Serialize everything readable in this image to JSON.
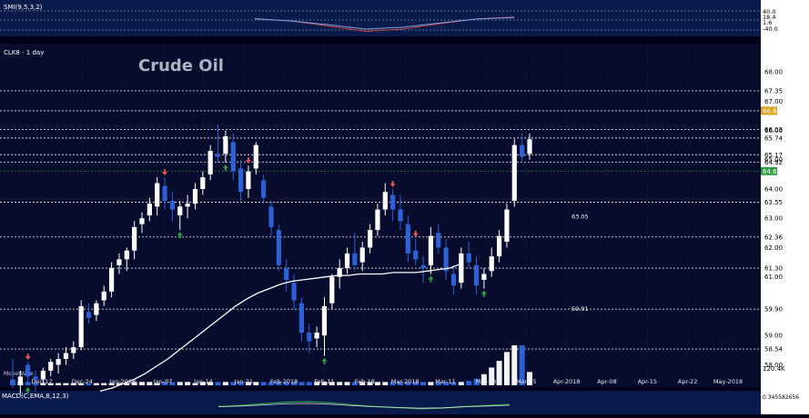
{
  "chart_data": [
    {
      "type": "line",
      "label": "SMI(9,5,3,2)",
      "right_scale": [
        "40.0",
        "18.4",
        "1.6",
        "-40.0"
      ],
      "series": [
        {
          "values": [
            5,
            -4,
            -20,
            -38,
            -30,
            -12,
            4,
            10
          ]
        }
      ]
    },
    {
      "type": "candlestick",
      "label": "CLK8 - 1 day",
      "title": "Crude Oil",
      "ylim": [
        57.3,
        68.9
      ],
      "right_ticks": [
        "68.00",
        "67.00",
        "66.00",
        "65.00",
        "64.00",
        "63.00",
        "62.00",
        "61.00",
        "59.00",
        "58.00"
      ],
      "level_lines": [
        {
          "value": 67.35,
          "label": "67.35"
        },
        {
          "value": 66.67,
          "label": "66.67",
          "badge_color": "#d9a21b"
        },
        {
          "value": 66.03,
          "label": "66.03"
        },
        {
          "value": 65.74,
          "label": "65.74"
        },
        {
          "value": 65.17,
          "label": "65.17"
        },
        {
          "value": 64.92,
          "label": "64.92"
        },
        {
          "value": 64.61,
          "label": "64.61",
          "badge_color": "#2ea043"
        },
        {
          "value": 63.55,
          "label": "63.55"
        },
        {
          "value": 62.36,
          "label": "62.36"
        },
        {
          "value": 61.3,
          "label": "61.30"
        },
        {
          "value": 59.9,
          "label": "59.90"
        },
        {
          "value": 58.54,
          "label": "58.54"
        }
      ],
      "inline_labels": [
        {
          "value": 63.05,
          "label": "63.05"
        },
        {
          "value": 59.91,
          "label": "59.91"
        }
      ],
      "x_ticks": [
        "Dec-17",
        "Dec-24",
        "Jan-2018",
        "Jan-07",
        "Jan-14",
        "Jan-21",
        "Feb-2018",
        "Feb-11",
        "Feb-18",
        "Mar-2018",
        "Mar-11",
        "Mar-18",
        "Mar-25",
        "Apr-2018",
        "Apr-08",
        "Apr-15",
        "Apr-22",
        "May-2018"
      ],
      "candles": [
        {
          "o": 57.5,
          "h": 58.2,
          "l": 57.2,
          "c": 57.4
        },
        {
          "o": 57.4,
          "h": 57.8,
          "l": 57.0,
          "c": 57.6
        },
        {
          "o": 58.0,
          "h": 58.1,
          "l": 57.3,
          "c": 57.6
        },
        {
          "o": 57.6,
          "h": 57.8,
          "l": 57.1,
          "c": 57.5
        },
        {
          "o": 57.5,
          "h": 57.9,
          "l": 57.3,
          "c": 57.8
        },
        {
          "o": 57.8,
          "h": 58.2,
          "l": 57.6,
          "c": 58.1
        },
        {
          "o": 58.0,
          "h": 58.4,
          "l": 57.7,
          "c": 58.2
        },
        {
          "o": 58.2,
          "h": 58.6,
          "l": 58.0,
          "c": 58.4
        },
        {
          "o": 58.4,
          "h": 58.8,
          "l": 58.2,
          "c": 58.6
        },
        {
          "o": 58.6,
          "h": 60.2,
          "l": 58.5,
          "c": 60.0
        },
        {
          "o": 59.8,
          "h": 60.1,
          "l": 59.4,
          "c": 59.6
        },
        {
          "o": 59.7,
          "h": 60.2,
          "l": 59.5,
          "c": 60.1
        },
        {
          "o": 60.2,
          "h": 60.7,
          "l": 60.0,
          "c": 60.5
        },
        {
          "o": 60.5,
          "h": 61.5,
          "l": 60.3,
          "c": 61.3
        },
        {
          "o": 61.4,
          "h": 61.8,
          "l": 61.1,
          "c": 61.6
        },
        {
          "o": 61.6,
          "h": 62.0,
          "l": 61.2,
          "c": 61.9
        },
        {
          "o": 61.9,
          "h": 62.9,
          "l": 61.6,
          "c": 62.7
        },
        {
          "o": 62.8,
          "h": 63.2,
          "l": 62.5,
          "c": 63.0
        },
        {
          "o": 63.1,
          "h": 63.7,
          "l": 62.9,
          "c": 63.5
        },
        {
          "o": 63.4,
          "h": 64.4,
          "l": 63.1,
          "c": 64.2
        },
        {
          "o": 64.1,
          "h": 64.4,
          "l": 63.3,
          "c": 63.6
        },
        {
          "o": 63.6,
          "h": 63.9,
          "l": 62.9,
          "c": 63.3
        },
        {
          "o": 63.1,
          "h": 63.6,
          "l": 62.6,
          "c": 63.4
        },
        {
          "o": 63.4,
          "h": 63.8,
          "l": 63.0,
          "c": 63.5
        },
        {
          "o": 63.5,
          "h": 64.2,
          "l": 63.3,
          "c": 64.0
        },
        {
          "o": 64.0,
          "h": 64.6,
          "l": 63.8,
          "c": 64.4
        },
        {
          "o": 64.5,
          "h": 65.5,
          "l": 64.3,
          "c": 65.3
        },
        {
          "o": 65.2,
          "h": 66.2,
          "l": 64.9,
          "c": 65.1
        },
        {
          "o": 65.2,
          "h": 66.0,
          "l": 64.9,
          "c": 65.8
        },
        {
          "o": 65.6,
          "h": 65.9,
          "l": 64.3,
          "c": 64.6
        },
        {
          "o": 64.7,
          "h": 65.0,
          "l": 63.6,
          "c": 63.9
        },
        {
          "o": 64.0,
          "h": 64.8,
          "l": 63.7,
          "c": 64.6
        },
        {
          "o": 64.7,
          "h": 65.6,
          "l": 64.5,
          "c": 65.5
        },
        {
          "o": 64.3,
          "h": 64.5,
          "l": 63.5,
          "c": 63.7
        },
        {
          "o": 63.4,
          "h": 63.6,
          "l": 62.4,
          "c": 62.7
        },
        {
          "o": 62.6,
          "h": 62.8,
          "l": 61.2,
          "c": 61.4
        },
        {
          "o": 61.3,
          "h": 61.6,
          "l": 60.5,
          "c": 60.9
        },
        {
          "o": 60.8,
          "h": 61.1,
          "l": 59.9,
          "c": 60.2
        },
        {
          "o": 60.1,
          "h": 60.3,
          "l": 58.8,
          "c": 59.1
        },
        {
          "o": 59.1,
          "h": 59.4,
          "l": 58.4,
          "c": 58.8
        },
        {
          "o": 58.9,
          "h": 59.3,
          "l": 58.6,
          "c": 59.1
        },
        {
          "o": 59.0,
          "h": 60.3,
          "l": 58.3,
          "c": 60.0
        },
        {
          "o": 60.1,
          "h": 61.1,
          "l": 59.9,
          "c": 61.0
        },
        {
          "o": 61.0,
          "h": 61.6,
          "l": 60.6,
          "c": 61.3
        },
        {
          "o": 61.3,
          "h": 62.0,
          "l": 61.1,
          "c": 61.8
        },
        {
          "o": 61.8,
          "h": 62.5,
          "l": 61.2,
          "c": 61.4
        },
        {
          "o": 61.5,
          "h": 62.2,
          "l": 61.2,
          "c": 62.0
        },
        {
          "o": 62.0,
          "h": 62.8,
          "l": 61.8,
          "c": 62.6
        },
        {
          "o": 62.6,
          "h": 63.5,
          "l": 62.4,
          "c": 63.3
        },
        {
          "o": 63.3,
          "h": 64.2,
          "l": 63.1,
          "c": 63.9
        },
        {
          "o": 63.8,
          "h": 64.0,
          "l": 62.9,
          "c": 63.3
        },
        {
          "o": 63.3,
          "h": 63.8,
          "l": 62.6,
          "c": 62.9
        },
        {
          "o": 62.8,
          "h": 63.1,
          "l": 61.5,
          "c": 61.8
        },
        {
          "o": 61.9,
          "h": 62.3,
          "l": 61.4,
          "c": 61.6
        },
        {
          "o": 61.4,
          "h": 61.7,
          "l": 60.8,
          "c": 61.3
        },
        {
          "o": 61.4,
          "h": 62.7,
          "l": 61.1,
          "c": 62.4
        },
        {
          "o": 62.5,
          "h": 62.8,
          "l": 61.8,
          "c": 62.0
        },
        {
          "o": 62.0,
          "h": 62.3,
          "l": 60.9,
          "c": 61.2
        },
        {
          "o": 61.1,
          "h": 61.4,
          "l": 60.4,
          "c": 60.7
        },
        {
          "o": 60.8,
          "h": 62.0,
          "l": 60.6,
          "c": 61.8
        },
        {
          "o": 61.8,
          "h": 62.2,
          "l": 61.3,
          "c": 61.5
        },
        {
          "o": 61.4,
          "h": 61.7,
          "l": 60.4,
          "c": 60.7
        },
        {
          "o": 60.9,
          "h": 61.3,
          "l": 60.6,
          "c": 61.1
        },
        {
          "o": 61.2,
          "h": 62.0,
          "l": 61.0,
          "c": 61.7
        },
        {
          "o": 61.7,
          "h": 62.6,
          "l": 61.5,
          "c": 62.4
        },
        {
          "o": 62.2,
          "h": 63.5,
          "l": 62.0,
          "c": 63.3
        },
        {
          "o": 63.6,
          "h": 65.7,
          "l": 63.4,
          "c": 65.5
        },
        {
          "o": 65.5,
          "h": 65.9,
          "l": 64.9,
          "c": 65.1
        },
        {
          "o": 65.2,
          "h": 65.9,
          "l": 65.0,
          "c": 65.7
        }
      ],
      "moving_average": {
        "color": "#ffffff",
        "values": [
          57.1,
          57.2,
          57.35,
          57.5,
          57.7,
          57.95,
          58.2,
          58.5,
          58.8,
          59.1,
          59.4,
          59.7,
          60.0,
          60.25,
          60.45,
          60.6,
          60.75,
          60.85,
          60.9,
          60.95,
          61.0,
          61.05,
          61.05,
          61.1,
          61.1,
          61.1,
          61.15,
          61.15,
          61.15,
          61.2,
          61.25,
          61.3,
          61.45
        ]
      },
      "arrows": [
        {
          "index": 2,
          "dir": "up",
          "color": "#2ea043"
        },
        {
          "index": 2,
          "dir": "down",
          "color": "#e05555"
        },
        {
          "index": 20,
          "dir": "down",
          "color": "#e05555"
        },
        {
          "index": 22,
          "dir": "up",
          "color": "#2ea043"
        },
        {
          "index": 28,
          "dir": "up",
          "color": "#2ea043"
        },
        {
          "index": 31,
          "dir": "down",
          "color": "#e05555"
        },
        {
          "index": 41,
          "dir": "up",
          "color": "#2ea043"
        },
        {
          "index": 50,
          "dir": "down",
          "color": "#e05555"
        },
        {
          "index": 53,
          "dir": "down",
          "color": "#e05555"
        },
        {
          "index": 55,
          "dir": "up",
          "color": "#2ea043"
        },
        {
          "index": 62,
          "dir": "up",
          "color": "#2ea043"
        }
      ],
      "volume_label": "120.4K",
      "volume": [
        4,
        3,
        3,
        2,
        2,
        2,
        2,
        2,
        2,
        2,
        2,
        2,
        2,
        2,
        2,
        2,
        3,
        3,
        3,
        2,
        3,
        3,
        3,
        3,
        2,
        3,
        3,
        3,
        3,
        3,
        3,
        3,
        3,
        3,
        3,
        3,
        3,
        3,
        3,
        3,
        3,
        3,
        3,
        3,
        3,
        3,
        3,
        3,
        3,
        3,
        3,
        3,
        3,
        3,
        3,
        3,
        3,
        3,
        3,
        3,
        4,
        6,
        10,
        16,
        22,
        30,
        36,
        36,
        12
      ]
    },
    {
      "type": "line",
      "label": "MACD(C,EMA,8,12,3)",
      "right_value": "0.345582656",
      "series": [
        {
          "values": [
            0.1,
            0.3,
            0.6,
            0.9,
            1.0,
            0.8,
            0.4,
            0.1,
            -0.1,
            -0.3,
            -0.2,
            0.1,
            0.3,
            0.5
          ]
        }
      ]
    }
  ],
  "watermark": "MoveWave"
}
